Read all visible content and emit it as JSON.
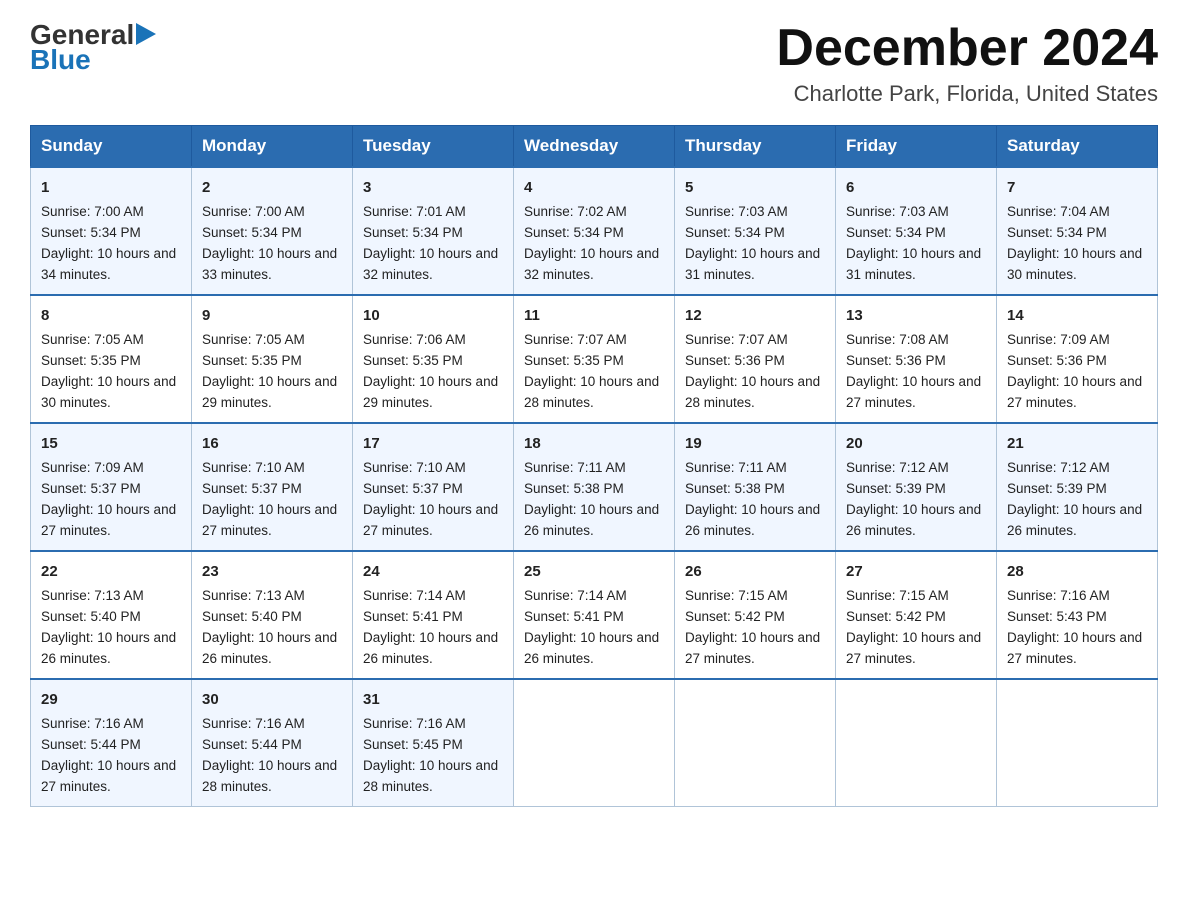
{
  "header": {
    "logo_general": "General",
    "logo_blue": "Blue",
    "month_title": "December 2024",
    "location": "Charlotte Park, Florida, United States"
  },
  "days_of_week": [
    "Sunday",
    "Monday",
    "Tuesday",
    "Wednesday",
    "Thursday",
    "Friday",
    "Saturday"
  ],
  "weeks": [
    [
      {
        "day": "1",
        "sunrise": "7:00 AM",
        "sunset": "5:34 PM",
        "daylight": "10 hours and 34 minutes."
      },
      {
        "day": "2",
        "sunrise": "7:00 AM",
        "sunset": "5:34 PM",
        "daylight": "10 hours and 33 minutes."
      },
      {
        "day": "3",
        "sunrise": "7:01 AM",
        "sunset": "5:34 PM",
        "daylight": "10 hours and 32 minutes."
      },
      {
        "day": "4",
        "sunrise": "7:02 AM",
        "sunset": "5:34 PM",
        "daylight": "10 hours and 32 minutes."
      },
      {
        "day": "5",
        "sunrise": "7:03 AM",
        "sunset": "5:34 PM",
        "daylight": "10 hours and 31 minutes."
      },
      {
        "day": "6",
        "sunrise": "7:03 AM",
        "sunset": "5:34 PM",
        "daylight": "10 hours and 31 minutes."
      },
      {
        "day": "7",
        "sunrise": "7:04 AM",
        "sunset": "5:34 PM",
        "daylight": "10 hours and 30 minutes."
      }
    ],
    [
      {
        "day": "8",
        "sunrise": "7:05 AM",
        "sunset": "5:35 PM",
        "daylight": "10 hours and 30 minutes."
      },
      {
        "day": "9",
        "sunrise": "7:05 AM",
        "sunset": "5:35 PM",
        "daylight": "10 hours and 29 minutes."
      },
      {
        "day": "10",
        "sunrise": "7:06 AM",
        "sunset": "5:35 PM",
        "daylight": "10 hours and 29 minutes."
      },
      {
        "day": "11",
        "sunrise": "7:07 AM",
        "sunset": "5:35 PM",
        "daylight": "10 hours and 28 minutes."
      },
      {
        "day": "12",
        "sunrise": "7:07 AM",
        "sunset": "5:36 PM",
        "daylight": "10 hours and 28 minutes."
      },
      {
        "day": "13",
        "sunrise": "7:08 AM",
        "sunset": "5:36 PM",
        "daylight": "10 hours and 27 minutes."
      },
      {
        "day": "14",
        "sunrise": "7:09 AM",
        "sunset": "5:36 PM",
        "daylight": "10 hours and 27 minutes."
      }
    ],
    [
      {
        "day": "15",
        "sunrise": "7:09 AM",
        "sunset": "5:37 PM",
        "daylight": "10 hours and 27 minutes."
      },
      {
        "day": "16",
        "sunrise": "7:10 AM",
        "sunset": "5:37 PM",
        "daylight": "10 hours and 27 minutes."
      },
      {
        "day": "17",
        "sunrise": "7:10 AM",
        "sunset": "5:37 PM",
        "daylight": "10 hours and 27 minutes."
      },
      {
        "day": "18",
        "sunrise": "7:11 AM",
        "sunset": "5:38 PM",
        "daylight": "10 hours and 26 minutes."
      },
      {
        "day": "19",
        "sunrise": "7:11 AM",
        "sunset": "5:38 PM",
        "daylight": "10 hours and 26 minutes."
      },
      {
        "day": "20",
        "sunrise": "7:12 AM",
        "sunset": "5:39 PM",
        "daylight": "10 hours and 26 minutes."
      },
      {
        "day": "21",
        "sunrise": "7:12 AM",
        "sunset": "5:39 PM",
        "daylight": "10 hours and 26 minutes."
      }
    ],
    [
      {
        "day": "22",
        "sunrise": "7:13 AM",
        "sunset": "5:40 PM",
        "daylight": "10 hours and 26 minutes."
      },
      {
        "day": "23",
        "sunrise": "7:13 AM",
        "sunset": "5:40 PM",
        "daylight": "10 hours and 26 minutes."
      },
      {
        "day": "24",
        "sunrise": "7:14 AM",
        "sunset": "5:41 PM",
        "daylight": "10 hours and 26 minutes."
      },
      {
        "day": "25",
        "sunrise": "7:14 AM",
        "sunset": "5:41 PM",
        "daylight": "10 hours and 26 minutes."
      },
      {
        "day": "26",
        "sunrise": "7:15 AM",
        "sunset": "5:42 PM",
        "daylight": "10 hours and 27 minutes."
      },
      {
        "day": "27",
        "sunrise": "7:15 AM",
        "sunset": "5:42 PM",
        "daylight": "10 hours and 27 minutes."
      },
      {
        "day": "28",
        "sunrise": "7:16 AM",
        "sunset": "5:43 PM",
        "daylight": "10 hours and 27 minutes."
      }
    ],
    [
      {
        "day": "29",
        "sunrise": "7:16 AM",
        "sunset": "5:44 PM",
        "daylight": "10 hours and 27 minutes."
      },
      {
        "day": "30",
        "sunrise": "7:16 AM",
        "sunset": "5:44 PM",
        "daylight": "10 hours and 28 minutes."
      },
      {
        "day": "31",
        "sunrise": "7:16 AM",
        "sunset": "5:45 PM",
        "daylight": "10 hours and 28 minutes."
      },
      null,
      null,
      null,
      null
    ]
  ]
}
